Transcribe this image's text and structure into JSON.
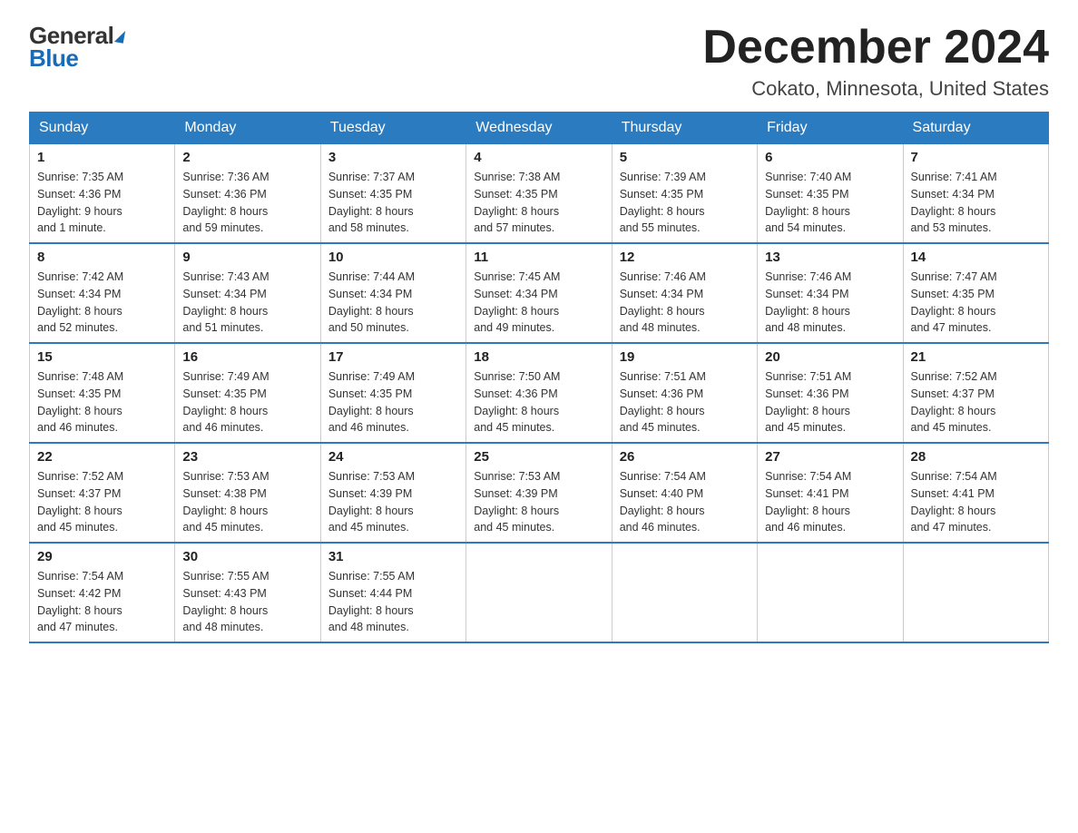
{
  "logo": {
    "general": "General",
    "blue": "Blue"
  },
  "title": "December 2024",
  "subtitle": "Cokato, Minnesota, United States",
  "days_of_week": [
    "Sunday",
    "Monday",
    "Tuesday",
    "Wednesday",
    "Thursday",
    "Friday",
    "Saturday"
  ],
  "weeks": [
    [
      {
        "day": "1",
        "sunrise": "7:35 AM",
        "sunset": "4:36 PM",
        "daylight": "9 hours and 1 minute."
      },
      {
        "day": "2",
        "sunrise": "7:36 AM",
        "sunset": "4:36 PM",
        "daylight": "8 hours and 59 minutes."
      },
      {
        "day": "3",
        "sunrise": "7:37 AM",
        "sunset": "4:35 PM",
        "daylight": "8 hours and 58 minutes."
      },
      {
        "day": "4",
        "sunrise": "7:38 AM",
        "sunset": "4:35 PM",
        "daylight": "8 hours and 57 minutes."
      },
      {
        "day": "5",
        "sunrise": "7:39 AM",
        "sunset": "4:35 PM",
        "daylight": "8 hours and 55 minutes."
      },
      {
        "day": "6",
        "sunrise": "7:40 AM",
        "sunset": "4:35 PM",
        "daylight": "8 hours and 54 minutes."
      },
      {
        "day": "7",
        "sunrise": "7:41 AM",
        "sunset": "4:34 PM",
        "daylight": "8 hours and 53 minutes."
      }
    ],
    [
      {
        "day": "8",
        "sunrise": "7:42 AM",
        "sunset": "4:34 PM",
        "daylight": "8 hours and 52 minutes."
      },
      {
        "day": "9",
        "sunrise": "7:43 AM",
        "sunset": "4:34 PM",
        "daylight": "8 hours and 51 minutes."
      },
      {
        "day": "10",
        "sunrise": "7:44 AM",
        "sunset": "4:34 PM",
        "daylight": "8 hours and 50 minutes."
      },
      {
        "day": "11",
        "sunrise": "7:45 AM",
        "sunset": "4:34 PM",
        "daylight": "8 hours and 49 minutes."
      },
      {
        "day": "12",
        "sunrise": "7:46 AM",
        "sunset": "4:34 PM",
        "daylight": "8 hours and 48 minutes."
      },
      {
        "day": "13",
        "sunrise": "7:46 AM",
        "sunset": "4:34 PM",
        "daylight": "8 hours and 48 minutes."
      },
      {
        "day": "14",
        "sunrise": "7:47 AM",
        "sunset": "4:35 PM",
        "daylight": "8 hours and 47 minutes."
      }
    ],
    [
      {
        "day": "15",
        "sunrise": "7:48 AM",
        "sunset": "4:35 PM",
        "daylight": "8 hours and 46 minutes."
      },
      {
        "day": "16",
        "sunrise": "7:49 AM",
        "sunset": "4:35 PM",
        "daylight": "8 hours and 46 minutes."
      },
      {
        "day": "17",
        "sunrise": "7:49 AM",
        "sunset": "4:35 PM",
        "daylight": "8 hours and 46 minutes."
      },
      {
        "day": "18",
        "sunrise": "7:50 AM",
        "sunset": "4:36 PM",
        "daylight": "8 hours and 45 minutes."
      },
      {
        "day": "19",
        "sunrise": "7:51 AM",
        "sunset": "4:36 PM",
        "daylight": "8 hours and 45 minutes."
      },
      {
        "day": "20",
        "sunrise": "7:51 AM",
        "sunset": "4:36 PM",
        "daylight": "8 hours and 45 minutes."
      },
      {
        "day": "21",
        "sunrise": "7:52 AM",
        "sunset": "4:37 PM",
        "daylight": "8 hours and 45 minutes."
      }
    ],
    [
      {
        "day": "22",
        "sunrise": "7:52 AM",
        "sunset": "4:37 PM",
        "daylight": "8 hours and 45 minutes."
      },
      {
        "day": "23",
        "sunrise": "7:53 AM",
        "sunset": "4:38 PM",
        "daylight": "8 hours and 45 minutes."
      },
      {
        "day": "24",
        "sunrise": "7:53 AM",
        "sunset": "4:39 PM",
        "daylight": "8 hours and 45 minutes."
      },
      {
        "day": "25",
        "sunrise": "7:53 AM",
        "sunset": "4:39 PM",
        "daylight": "8 hours and 45 minutes."
      },
      {
        "day": "26",
        "sunrise": "7:54 AM",
        "sunset": "4:40 PM",
        "daylight": "8 hours and 46 minutes."
      },
      {
        "day": "27",
        "sunrise": "7:54 AM",
        "sunset": "4:41 PM",
        "daylight": "8 hours and 46 minutes."
      },
      {
        "day": "28",
        "sunrise": "7:54 AM",
        "sunset": "4:41 PM",
        "daylight": "8 hours and 47 minutes."
      }
    ],
    [
      {
        "day": "29",
        "sunrise": "7:54 AM",
        "sunset": "4:42 PM",
        "daylight": "8 hours and 47 minutes."
      },
      {
        "day": "30",
        "sunrise": "7:55 AM",
        "sunset": "4:43 PM",
        "daylight": "8 hours and 48 minutes."
      },
      {
        "day": "31",
        "sunrise": "7:55 AM",
        "sunset": "4:44 PM",
        "daylight": "8 hours and 48 minutes."
      },
      null,
      null,
      null,
      null
    ]
  ],
  "labels": {
    "sunrise": "Sunrise:",
    "sunset": "Sunset:",
    "daylight": "Daylight:"
  }
}
